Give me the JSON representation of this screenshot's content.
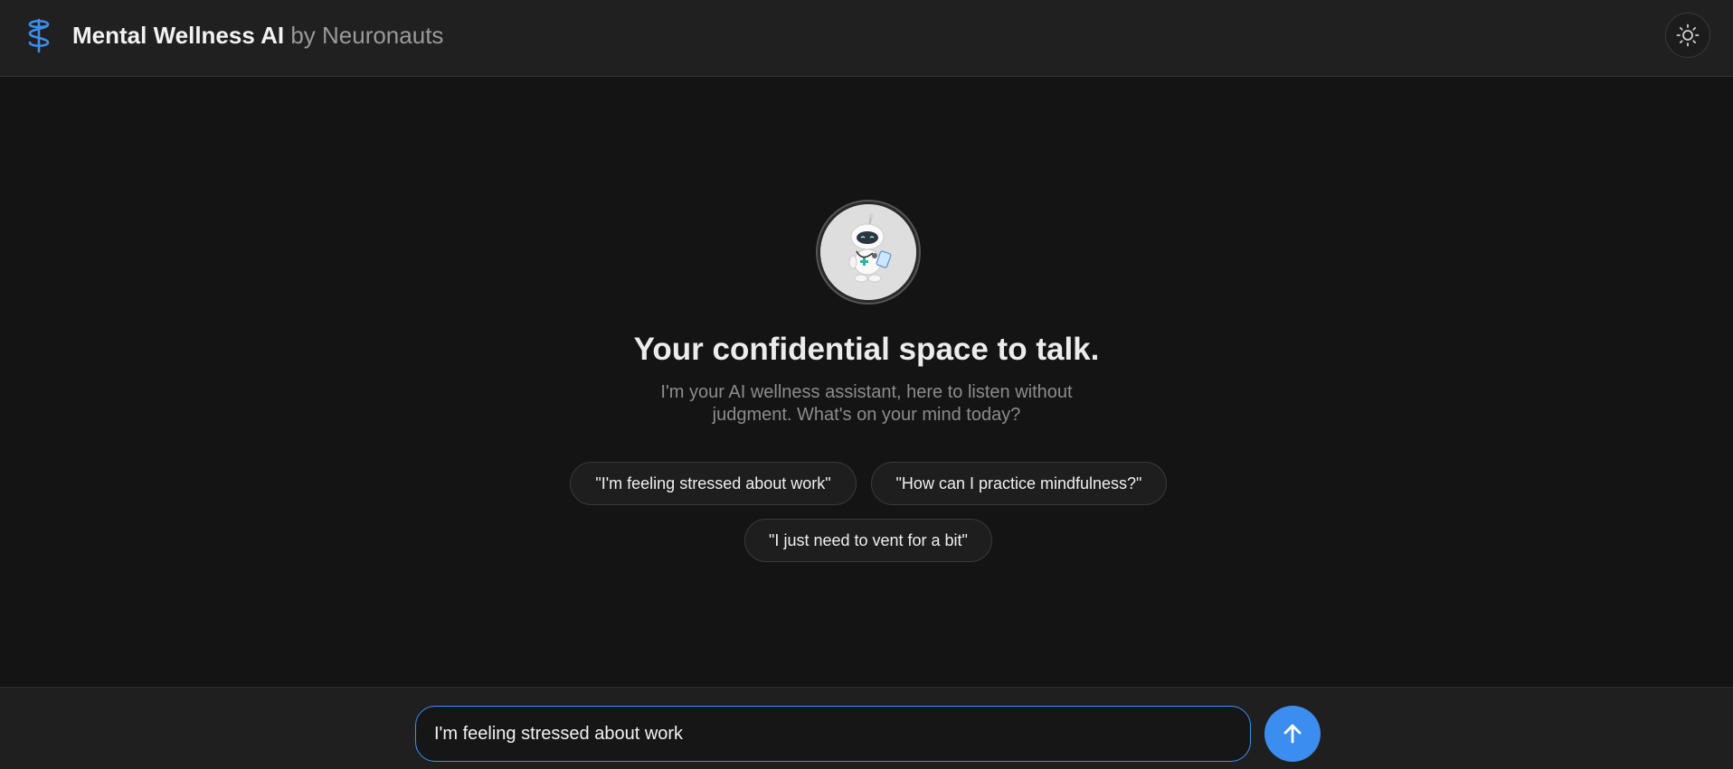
{
  "header": {
    "app_name": "Mental Wellness AI",
    "by_text": "by Neuronauts",
    "logo_icon": "caduceus-icon",
    "theme_toggle_icon": "sun-icon"
  },
  "hero": {
    "avatar_icon": "robot-doctor-icon",
    "title": "Your confidential space to talk.",
    "subtitle": "I'm your AI wellness assistant, here to listen without judgment. What's on your mind today?"
  },
  "suggestions": [
    "\"I'm feeling stressed about work\"",
    "\"How can I practice mindfulness?\"",
    "\"I just need to vent for a bit\""
  ],
  "composer": {
    "value": "I'm feeling stressed about work",
    "send_icon": "arrow-up-icon"
  },
  "colors": {
    "accent": "#3b8ef0",
    "background": "#141414",
    "header_bg": "#202020"
  }
}
